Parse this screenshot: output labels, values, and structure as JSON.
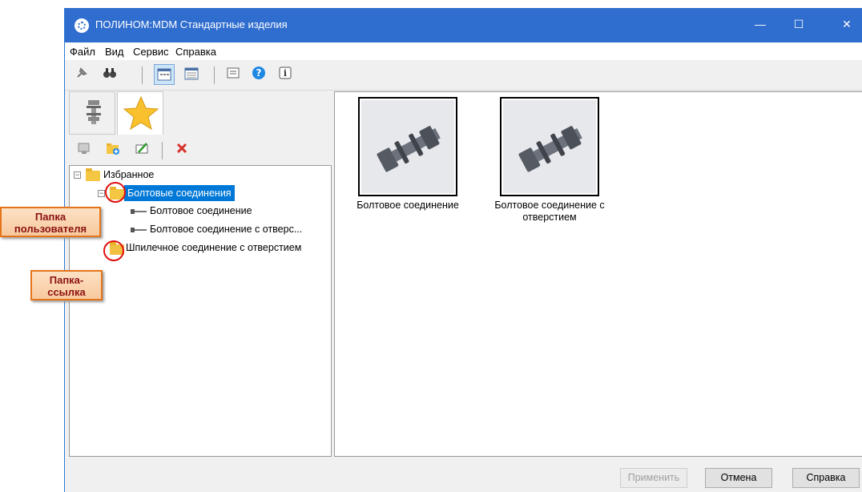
{
  "window": {
    "title": "ПОЛИНОМ:MDM Стандартные изделия",
    "controls": {
      "minimize": "—",
      "maximize": "☐",
      "close": "✕"
    }
  },
  "menu": [
    "Файл",
    "Вид",
    "Сервис",
    "Справка"
  ],
  "toolbar": {
    "buttons": [
      "pin-icon",
      "binoculars-icon",
      "large-icons-view-icon",
      "table-view-icon",
      "list-view-icon",
      "help-icon",
      "info-icon"
    ],
    "pressed": "large-icons-view-icon"
  },
  "left_tabs": {
    "active": "favorites",
    "items": [
      "catalog-tab",
      "favorites-tab"
    ]
  },
  "panel_toolbar": [
    "apply-icon",
    "add-folder-icon",
    "rename-icon",
    "delete-icon"
  ],
  "tree": {
    "root": "Избранное",
    "items": [
      {
        "label": "Болтовые соединения",
        "type": "user-folder",
        "selected": true
      },
      {
        "label": "Болтовое соединение",
        "type": "item"
      },
      {
        "label": "Болтовое соединение с отверс...",
        "type": "item"
      },
      {
        "label": "Шпилечное соединение с отверстием",
        "type": "link-folder"
      }
    ]
  },
  "thumbnails": [
    {
      "label": "Болтовое соединение"
    },
    {
      "label": "Болтовое соединение с отверстием"
    }
  ],
  "buttons": {
    "apply": "Применить",
    "cancel": "Отмена",
    "help": "Справка"
  },
  "callouts": {
    "user_folder": "Папка пользователя",
    "link_folder": "Папка-ссылка"
  },
  "colors": {
    "titlebar": "#2f6dce",
    "selection": "#0078d7",
    "callout_border": "#e4741a",
    "callout_text": "#8b1111",
    "ring": "#e01010"
  }
}
